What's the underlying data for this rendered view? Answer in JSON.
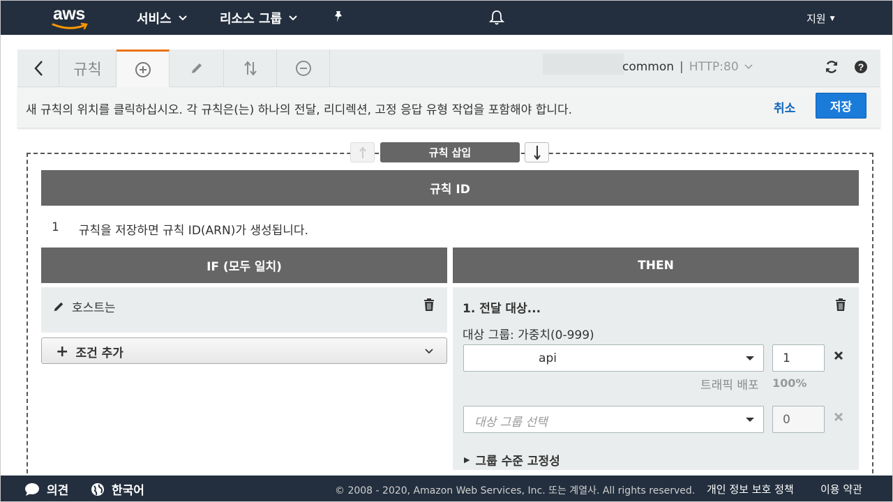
{
  "nav": {
    "logo": "aws",
    "services": "서비스",
    "resource_groups": "리소스 그룹",
    "support": "지원"
  },
  "toolbar": {
    "title": "규칙",
    "listener_name": "common",
    "listener_sep": "|",
    "listener_protocol": "HTTP:80"
  },
  "infobar": {
    "message": "새 규칙의 위치를 클릭하십시오. 각 규칙은(는) 하나의 전달, 리디렉션, 고정 응답 유형 작업을 포함해야 합니다.",
    "cancel": "취소",
    "save": "저장"
  },
  "rule": {
    "insert_label": "규칙 삽입",
    "rule_id_header": "규칙 ID",
    "rule_number": "1",
    "rule_id_note": "규칙을 저장하면 규칙 ID(ARN)가 생성됩니다.",
    "if_header": "IF (모두 일치)",
    "then_header": "THEN",
    "condition_label": "호스트는",
    "add_condition": "조건 추가",
    "action_title": "1. 전달 대상...",
    "target_group_label": "대상 그룹: 가중치(0-999)",
    "target_group_1": "api",
    "weight_1": "1",
    "traffic_label": "트래픽 배포",
    "traffic_value": "100%",
    "target_group_placeholder": "대상 그룹 선택",
    "weight_2": "0",
    "stickiness": "그룹 수준 고정성"
  },
  "footer": {
    "feedback": "의견",
    "language": "한국어",
    "copyright": "© 2008 - 2020, Amazon Web Services, Inc. 또는 계열사. All rights reserved.",
    "privacy": "개인 정보 보호 정책",
    "terms": "이용 약관"
  },
  "colors": {
    "nav_bg": "#232f3e",
    "accent_orange": "#ec7211",
    "primary_blue": "#1a7bd9",
    "link_blue": "#1166bb",
    "band_gray": "#666666"
  }
}
